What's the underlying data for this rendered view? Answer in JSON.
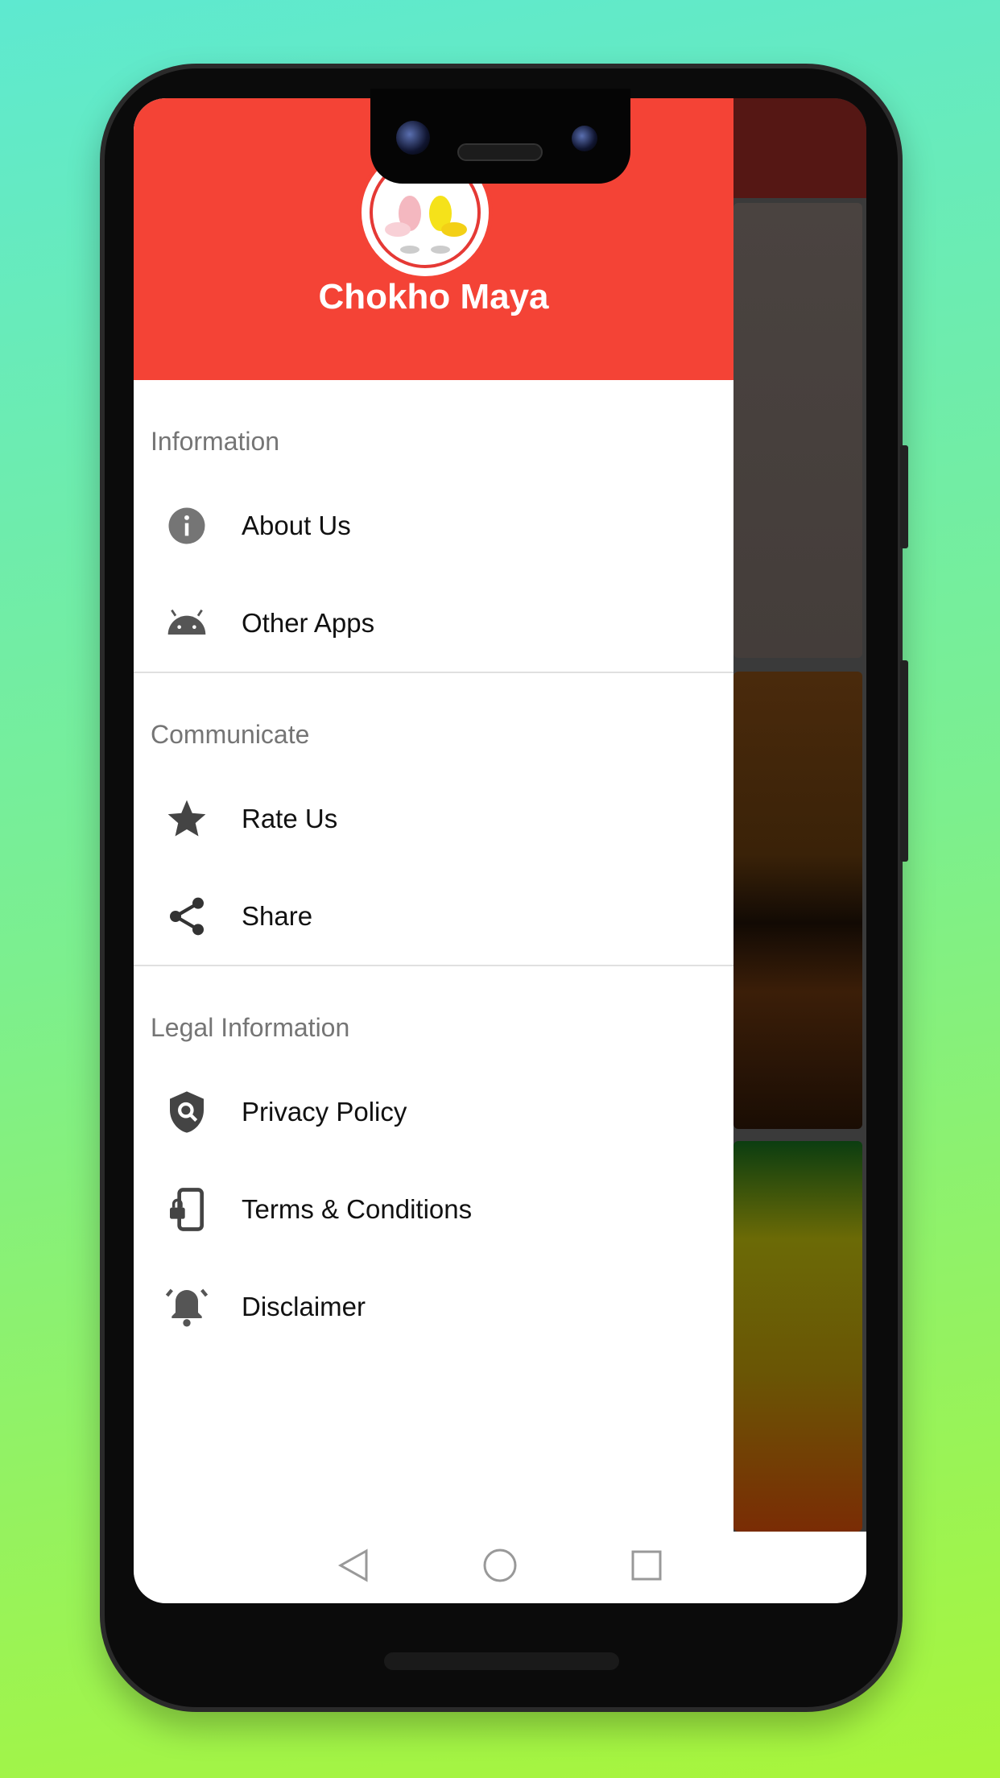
{
  "app": {
    "title": "Chokho Maya",
    "accent": "#f44336"
  },
  "drawer": {
    "sections": [
      {
        "label": "Information",
        "items": [
          {
            "label": "About Us",
            "icon": "info-icon"
          },
          {
            "label": "Other Apps",
            "icon": "android-icon"
          }
        ]
      },
      {
        "label": "Communicate",
        "items": [
          {
            "label": "Rate Us",
            "icon": "star-icon"
          },
          {
            "label": "Share",
            "icon": "share-icon"
          }
        ]
      },
      {
        "label": "Legal Information",
        "items": [
          {
            "label": "Privacy Policy",
            "icon": "shield-search-icon"
          },
          {
            "label": "Terms & Conditions",
            "icon": "phone-lock-icon"
          },
          {
            "label": "Disclaimer",
            "icon": "alarm-bell-icon"
          }
        ]
      }
    ]
  },
  "navbar": {
    "buttons": [
      "back-icon",
      "home-icon",
      "recents-icon"
    ]
  }
}
